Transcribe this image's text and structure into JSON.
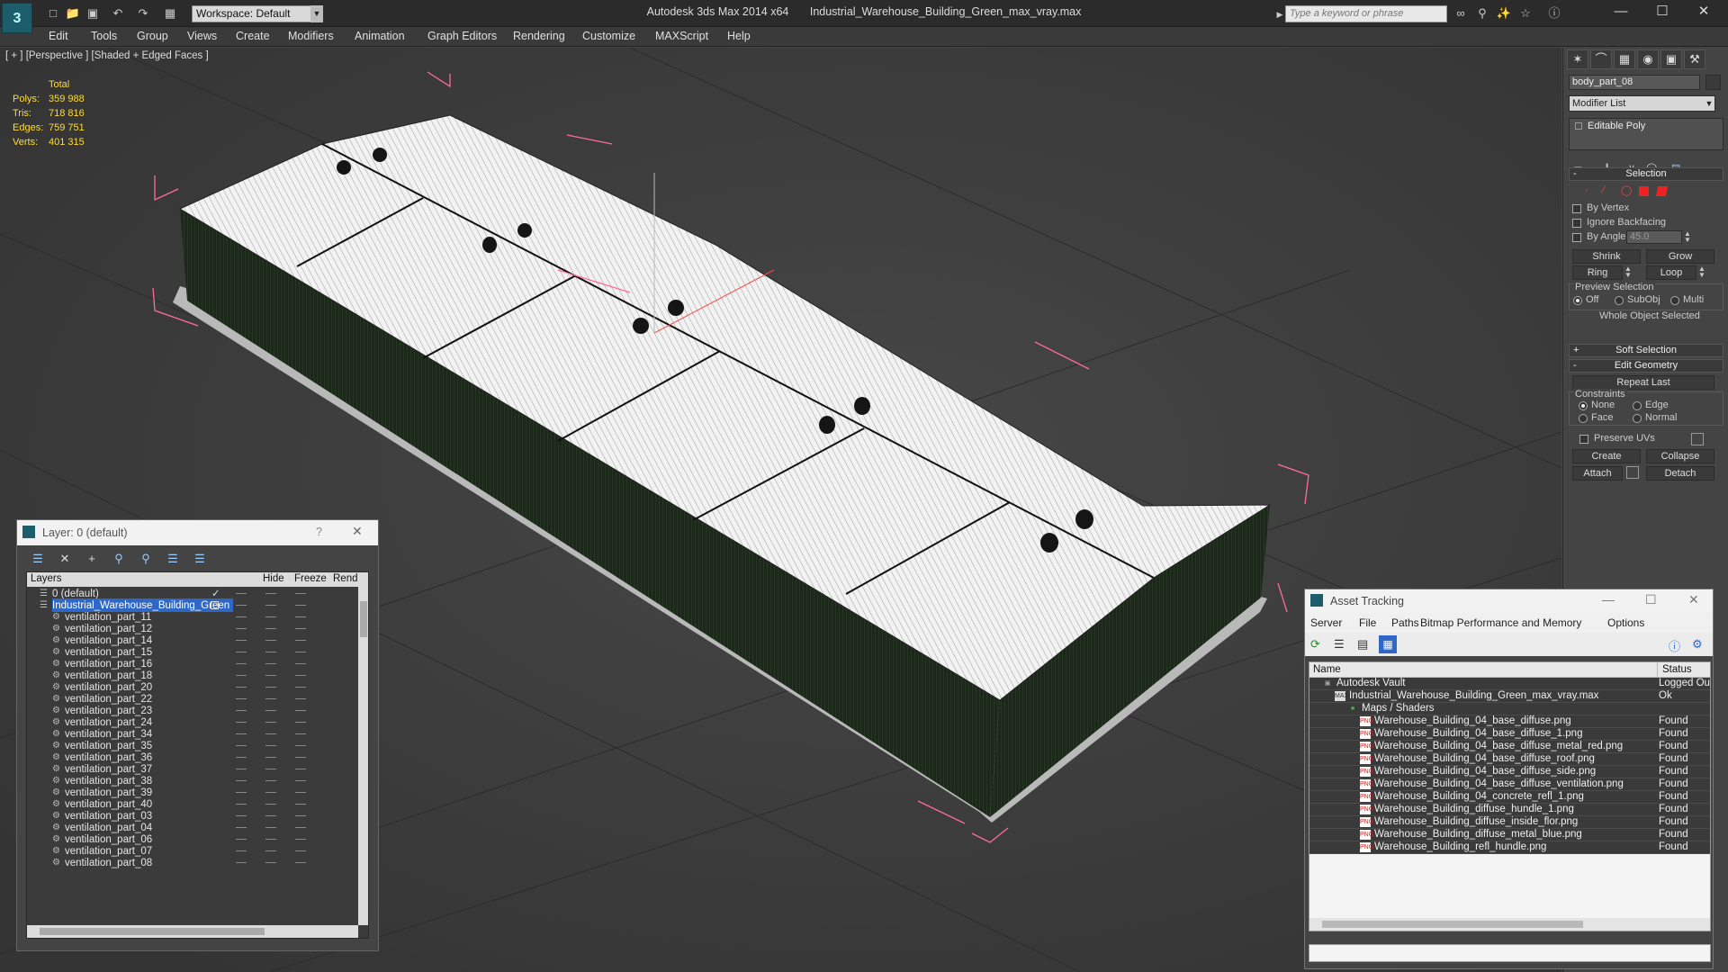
{
  "titlebar": {
    "workspace": "Workspace: Default",
    "app_name": "Autodesk 3ds Max  2014 x64",
    "file_name": "Industrial_Warehouse_Building_Green_max_vray.max",
    "search_placeholder": "Type a keyword or phrase"
  },
  "menubar": {
    "items": [
      "Edit",
      "Tools",
      "Group",
      "Views",
      "Create",
      "Modifiers",
      "Animation",
      "Graph Editors",
      "Rendering",
      "Customize",
      "MAXScript",
      "Help"
    ]
  },
  "viewport": {
    "label": "[ + ] [Perspective ] [Shaded + Edged Faces ]",
    "stats": {
      "header": "Total",
      "polys_label": "Polys:",
      "polys": "359 988",
      "tris_label": "Tris:",
      "tris": "718 816",
      "edges_label": "Edges:",
      "edges": "759 751",
      "verts_label": "Verts:",
      "verts": "401 315"
    }
  },
  "command_panel": {
    "object_name": "body_part_08",
    "modifier_list": "Modifier List",
    "stack_item": "Editable Poly",
    "selection": {
      "title": "Selection",
      "by_vertex": "By Vertex",
      "ignore_backfacing": "Ignore Backfacing",
      "by_angle": "By Angle:",
      "angle_value": "45.0",
      "shrink": "Shrink",
      "grow": "Grow",
      "ring": "Ring",
      "loop": "Loop",
      "preview_selection": "Preview Selection",
      "preview_off": "Off",
      "preview_subobj": "SubObj",
      "preview_multi": "Multi",
      "status": "Whole Object Selected"
    },
    "soft_selection": "Soft Selection",
    "edit_geometry": {
      "title": "Edit Geometry",
      "repeat_last": "Repeat Last",
      "constraints": "Constraints",
      "none": "None",
      "edge": "Edge",
      "face": "Face",
      "normal": "Normal",
      "preserve_uvs": "Preserve UVs",
      "create": "Create",
      "collapse": "Collapse",
      "attach": "Attach",
      "detach": "Detach"
    }
  },
  "layer_panel": {
    "title": "Layer: 0 (default)",
    "help": "?",
    "columns": [
      "Layers",
      "Hide",
      "Freeze",
      "Rend"
    ],
    "rows": [
      "0 (default)",
      "Industrial_Warehouse_Building_Green",
      "ventilation_part_11",
      "ventilation_part_12",
      "ventilation_part_14",
      "ventilation_part_15",
      "ventilation_part_16",
      "ventilation_part_18",
      "ventilation_part_20",
      "ventilation_part_22",
      "ventilation_part_23",
      "ventilation_part_24",
      "ventilation_part_34",
      "ventilation_part_35",
      "ventilation_part_36",
      "ventilation_part_37",
      "ventilation_part_38",
      "ventilation_part_39",
      "ventilation_part_40",
      "ventilation_part_03",
      "ventilation_part_04",
      "ventilation_part_06",
      "ventilation_part_07",
      "ventilation_part_08"
    ]
  },
  "asset_tracking": {
    "title": "Asset Tracking",
    "menu": [
      "Server",
      "File",
      "Paths",
      "Bitmap Performance and Memory",
      "Options"
    ],
    "columns": [
      "Name",
      "Status"
    ],
    "rows": [
      {
        "name": "Autodesk Vault",
        "status": "Logged Ou"
      },
      {
        "name": "Industrial_Warehouse_Building_Green_max_vray.max",
        "status": "Ok"
      },
      {
        "name": "Maps / Shaders",
        "status": ""
      },
      {
        "name": "Warehouse_Building_04_base_diffuse.png",
        "status": "Found"
      },
      {
        "name": "Warehouse_Building_04_base_diffuse_1.png",
        "status": "Found"
      },
      {
        "name": "Warehouse_Building_04_base_diffuse_metal_red.png",
        "status": "Found"
      },
      {
        "name": "Warehouse_Building_04_base_diffuse_roof.png",
        "status": "Found"
      },
      {
        "name": "Warehouse_Building_04_base_diffuse_side.png",
        "status": "Found"
      },
      {
        "name": "Warehouse_Building_04_base_diffuse_ventilation.png",
        "status": "Found"
      },
      {
        "name": "Warehouse_Building_04_concrete_refl_1.png",
        "status": "Found"
      },
      {
        "name": "Warehouse_Building_diffuse_hundle_1.png",
        "status": "Found"
      },
      {
        "name": "Warehouse_Building_diffuse_inside_flor.png",
        "status": "Found"
      },
      {
        "name": "Warehouse_Building_diffuse_metal_blue.png",
        "status": "Found"
      },
      {
        "name": "Warehouse_Building_refl_hundle.png",
        "status": "Found"
      }
    ]
  },
  "colors": {
    "stats_text": "#ffdc3c",
    "selection_blue": "#2e67c5",
    "bbox_pink": "#ff6b9a",
    "roof": "#f0f0f0",
    "wall": "#1e2a1c"
  }
}
